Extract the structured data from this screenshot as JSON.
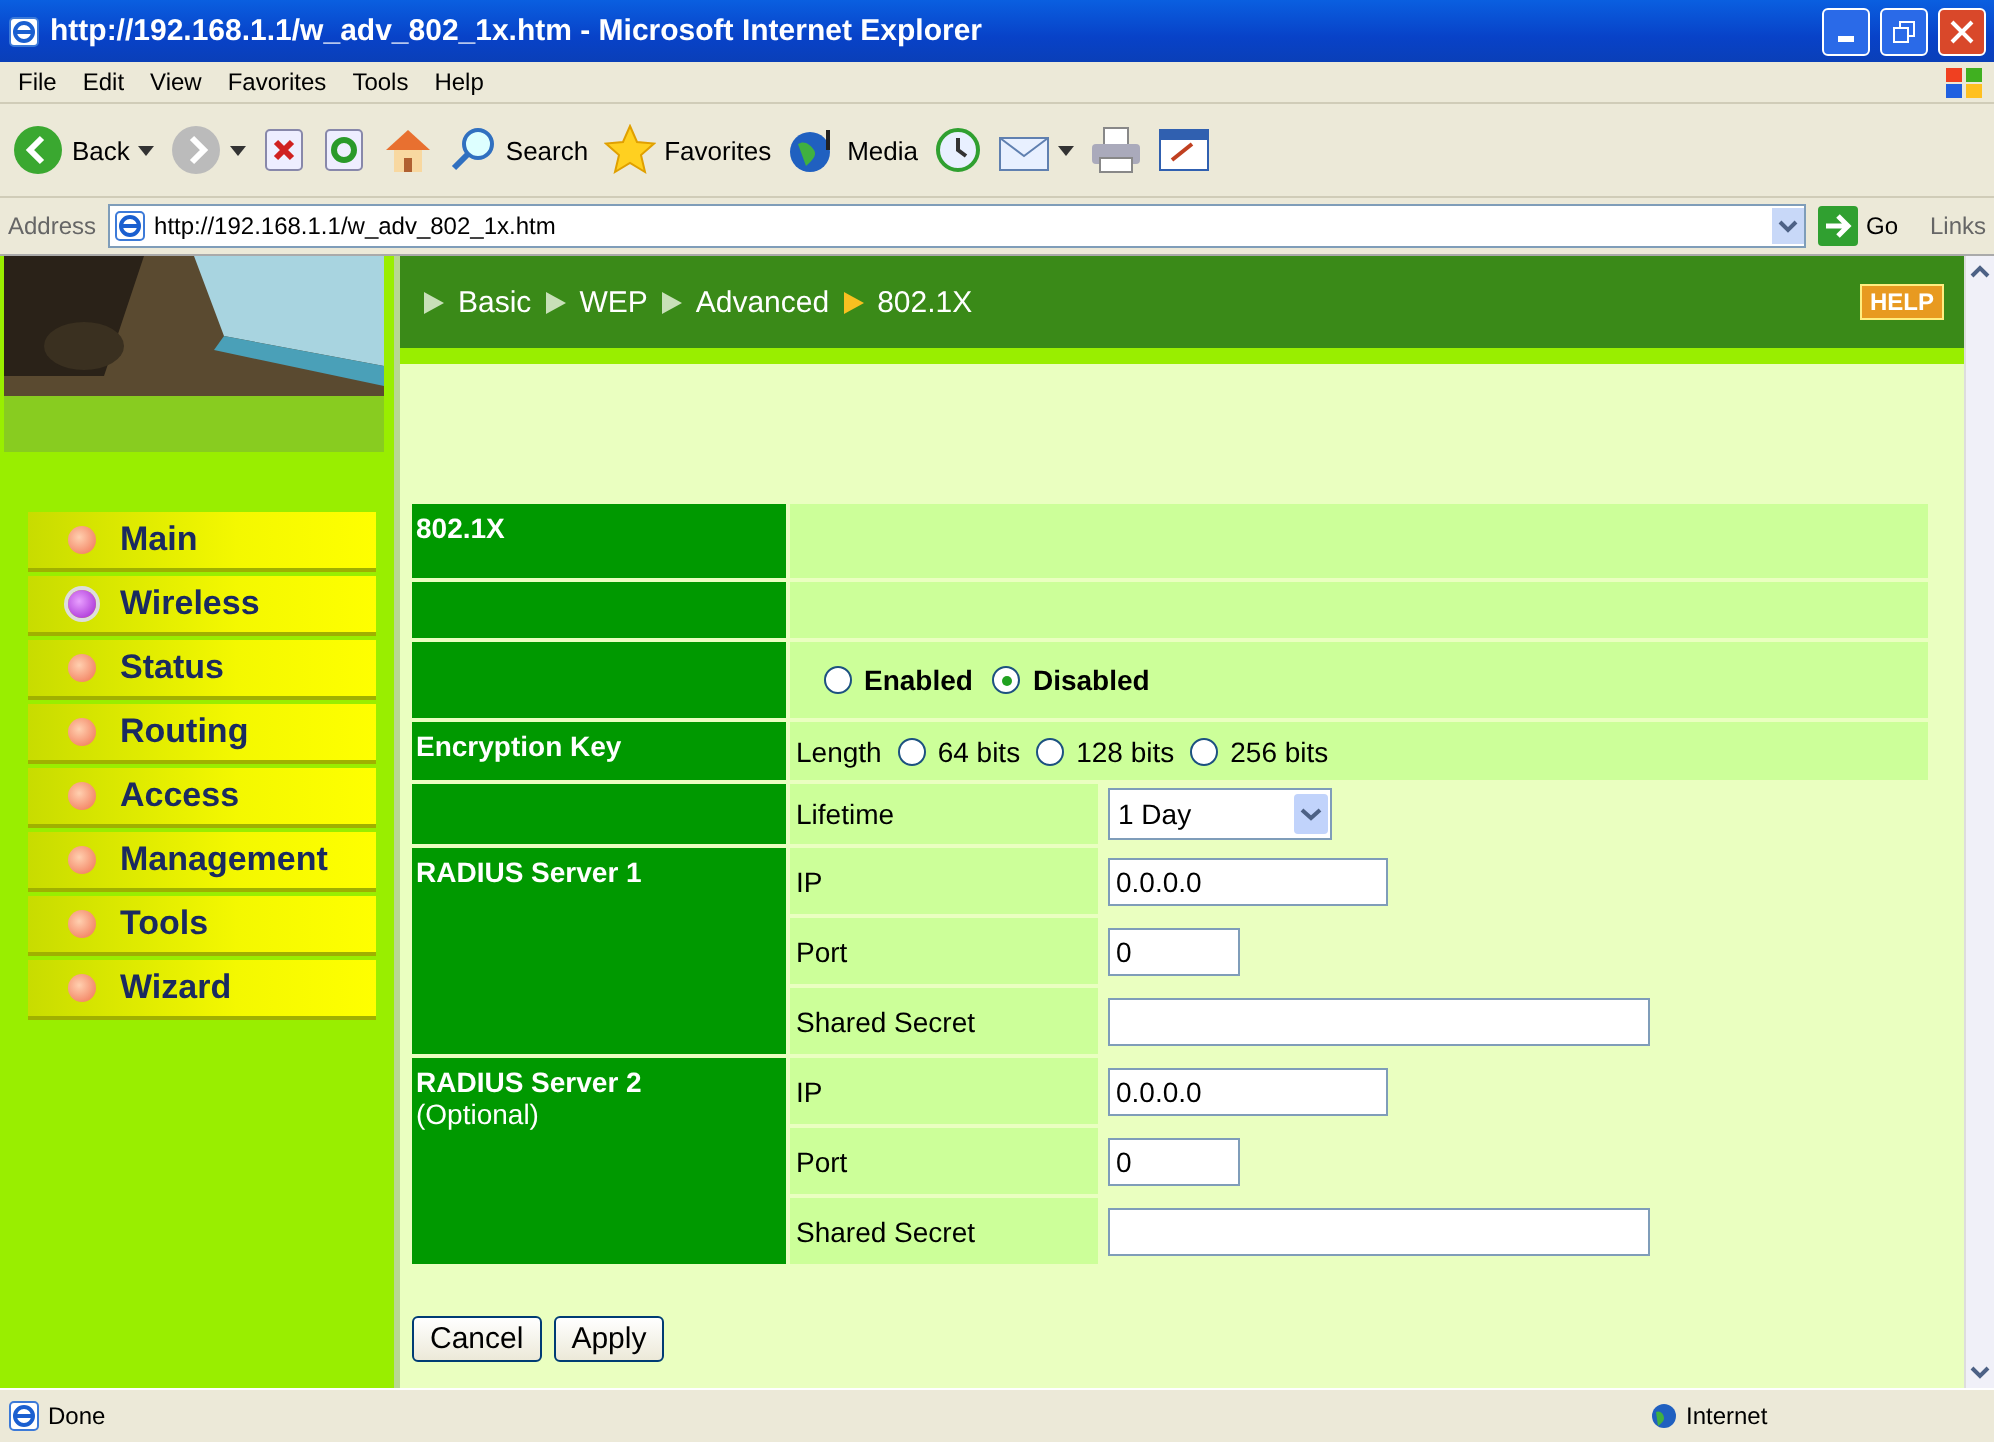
{
  "window": {
    "title": "http://192.168.1.1/w_adv_802_1x.htm - Microsoft Internet Explorer"
  },
  "menu": [
    "File",
    "Edit",
    "View",
    "Favorites",
    "Tools",
    "Help"
  ],
  "toolbar": [
    {
      "kind": "back",
      "label": "Back"
    },
    {
      "kind": "forward"
    },
    {
      "kind": "stop"
    },
    {
      "kind": "refresh"
    },
    {
      "kind": "home"
    },
    {
      "kind": "search",
      "label": "Search"
    },
    {
      "kind": "favorites",
      "label": "Favorites"
    },
    {
      "kind": "media",
      "label": "Media"
    },
    {
      "kind": "history"
    },
    {
      "kind": "mail"
    },
    {
      "kind": "print"
    },
    {
      "kind": "edit"
    }
  ],
  "address": {
    "label": "Address",
    "url": "http://192.168.1.1/w_adv_802_1x.htm",
    "go": "Go",
    "links": "Links"
  },
  "sidebar": {
    "items": [
      {
        "label": "Main",
        "selected": false
      },
      {
        "label": "Wireless",
        "selected": true
      },
      {
        "label": "Status",
        "selected": false
      },
      {
        "label": "Routing",
        "selected": false
      },
      {
        "label": "Access",
        "selected": false
      },
      {
        "label": "Management",
        "selected": false
      },
      {
        "label": "Tools",
        "selected": false
      },
      {
        "label": "Wizard",
        "selected": false
      }
    ]
  },
  "breadcrumb": [
    {
      "label": "Basic",
      "current": false
    },
    {
      "label": "WEP",
      "current": false
    },
    {
      "label": "Advanced",
      "current": false
    },
    {
      "label": "802.1X",
      "current": true
    }
  ],
  "help": "HELP",
  "form": {
    "heading": "802.1X",
    "status_options": [
      {
        "label": "Enabled",
        "selected": false
      },
      {
        "label": "Disabled",
        "selected": true
      }
    ],
    "encryption": {
      "label": "Encryption Key",
      "length_label": "Length",
      "options": [
        {
          "label": "64 bits",
          "selected": false
        },
        {
          "label": "128 bits",
          "selected": false
        },
        {
          "label": "256 bits",
          "selected": false
        }
      ]
    },
    "lifetime": {
      "label": "Lifetime",
      "value": "1 Day"
    },
    "servers": [
      {
        "title": "RADIUS Server 1",
        "fields": [
          {
            "label": "IP",
            "value": "0.0.0.0",
            "kind": "short"
          },
          {
            "label": "Port",
            "value": "0",
            "kind": "tiny"
          },
          {
            "label": "Shared Secret",
            "kind": "long"
          }
        ]
      },
      {
        "title": "RADIUS Server 2",
        "note": "(Optional)",
        "fields": [
          {
            "label": "IP",
            "value": "0.0.0.0",
            "kind": "short"
          },
          {
            "label": "Port",
            "value": "0",
            "kind": "tiny"
          },
          {
            "label": "Shared Secret",
            "kind": "long"
          }
        ]
      }
    ]
  },
  "buttons": [
    "Cancel",
    "Apply"
  ],
  "status_bar": {
    "text": "Done",
    "zone": "Internet"
  }
}
